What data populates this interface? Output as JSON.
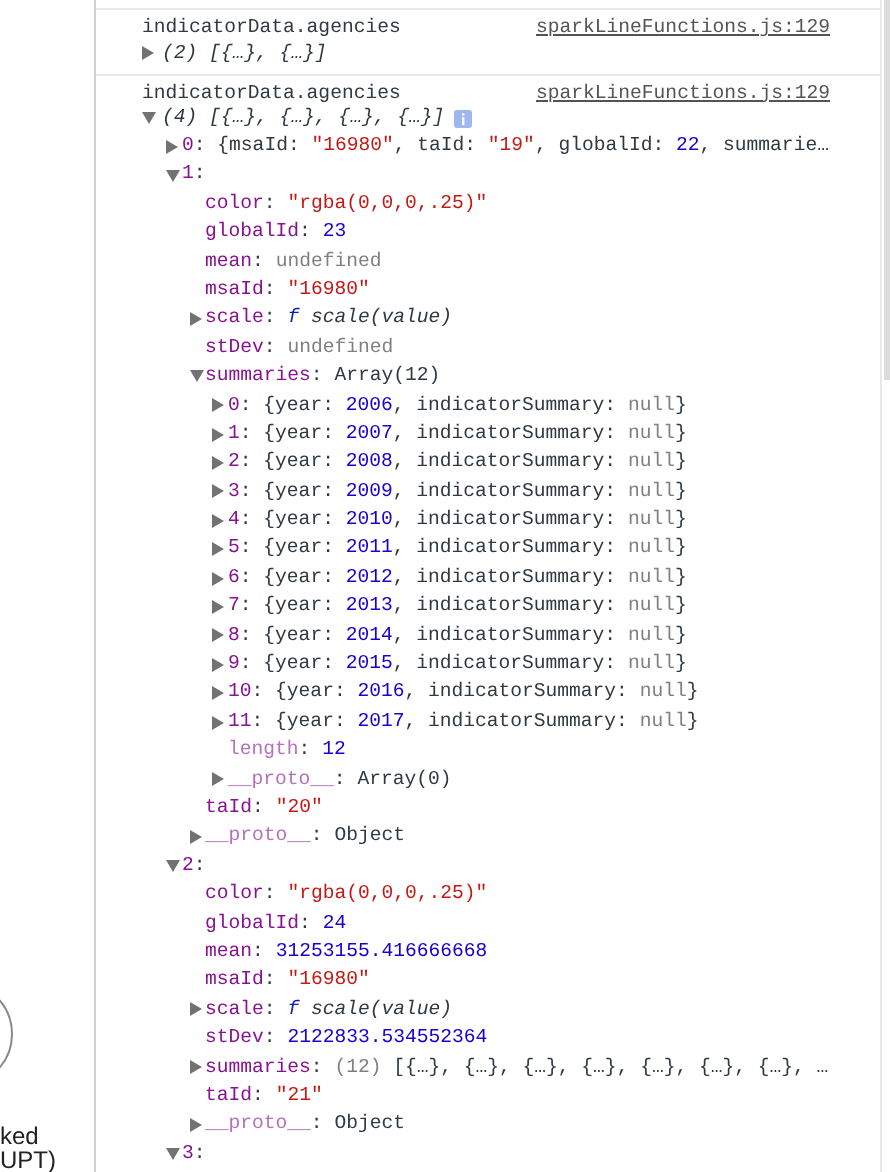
{
  "left_panel": {
    "texts": [
      "ked",
      "UPT)"
    ]
  },
  "console": {
    "messages": [
      {
        "label": "indicatorData.agencies",
        "source": "sparkLineFunctions.js:129",
        "tree": {
          "expanded": false,
          "summary": [
            {
              "text": "(2) [{…}, {…}]",
              "kind": "italic"
            }
          ]
        }
      },
      {
        "label": "indicatorData.agencies",
        "source": "sparkLineFunctions.js:129",
        "tree": {
          "expanded": true,
          "info_badge": true,
          "summary": [
            {
              "text": "(4) [{…}, {…}, {…}, {…}]",
              "kind": "italic"
            }
          ],
          "children": [
            {
              "key": "0:",
              "expanded": false,
              "value": [
                {
                  "text": "{msaId: ",
                  "kind": "plain"
                },
                {
                  "text": "\"16980\"",
                  "kind": "string"
                },
                {
                  "text": ", taId: ",
                  "kind": "plain"
                },
                {
                  "text": "\"19\"",
                  "kind": "string"
                },
                {
                  "text": ", globalId: ",
                  "kind": "plain"
                },
                {
                  "text": "22",
                  "kind": "number"
                },
                {
                  "text": ", summarie…",
                  "kind": "plain"
                }
              ]
            },
            {
              "key": "1:",
              "expanded": true,
              "children": [
                {
                  "key": "color:",
                  "value": [
                    {
                      "text": "\"rgba(0,0,0,.25)\"",
                      "kind": "string"
                    }
                  ]
                },
                {
                  "key": "globalId:",
                  "value": [
                    {
                      "text": "23",
                      "kind": "number"
                    }
                  ]
                },
                {
                  "key": "mean:",
                  "value": [
                    {
                      "text": "undefined",
                      "kind": "muted"
                    }
                  ]
                },
                {
                  "key": "msaId:",
                  "value": [
                    {
                      "text": "\"16980\"",
                      "kind": "string"
                    }
                  ]
                },
                {
                  "key": "scale:",
                  "expanded": false,
                  "value": [
                    {
                      "text": "f",
                      "kind": "function"
                    },
                    {
                      "text": " scale(value)",
                      "kind": "italic"
                    }
                  ]
                },
                {
                  "key": "stDev:",
                  "value": [
                    {
                      "text": "undefined",
                      "kind": "muted"
                    }
                  ]
                },
                {
                  "key": "summaries:",
                  "expanded": true,
                  "value": [
                    {
                      "text": "Array(12)",
                      "kind": "plain"
                    }
                  ],
                  "children": [
                    {
                      "key": "0:",
                      "expanded": false,
                      "value": [
                        {
                          "text": "{year: ",
                          "kind": "plain"
                        },
                        {
                          "text": "2006",
                          "kind": "number"
                        },
                        {
                          "text": ", indicatorSummary: ",
                          "kind": "plain"
                        },
                        {
                          "text": "null",
                          "kind": "muted"
                        },
                        {
                          "text": "}",
                          "kind": "plain"
                        }
                      ]
                    },
                    {
                      "key": "1:",
                      "expanded": false,
                      "value": [
                        {
                          "text": "{year: ",
                          "kind": "plain"
                        },
                        {
                          "text": "2007",
                          "kind": "number"
                        },
                        {
                          "text": ", indicatorSummary: ",
                          "kind": "plain"
                        },
                        {
                          "text": "null",
                          "kind": "muted"
                        },
                        {
                          "text": "}",
                          "kind": "plain"
                        }
                      ]
                    },
                    {
                      "key": "2:",
                      "expanded": false,
                      "value": [
                        {
                          "text": "{year: ",
                          "kind": "plain"
                        },
                        {
                          "text": "2008",
                          "kind": "number"
                        },
                        {
                          "text": ", indicatorSummary: ",
                          "kind": "plain"
                        },
                        {
                          "text": "null",
                          "kind": "muted"
                        },
                        {
                          "text": "}",
                          "kind": "plain"
                        }
                      ]
                    },
                    {
                      "key": "3:",
                      "expanded": false,
                      "value": [
                        {
                          "text": "{year: ",
                          "kind": "plain"
                        },
                        {
                          "text": "2009",
                          "kind": "number"
                        },
                        {
                          "text": ", indicatorSummary: ",
                          "kind": "plain"
                        },
                        {
                          "text": "null",
                          "kind": "muted"
                        },
                        {
                          "text": "}",
                          "kind": "plain"
                        }
                      ]
                    },
                    {
                      "key": "4:",
                      "expanded": false,
                      "value": [
                        {
                          "text": "{year: ",
                          "kind": "plain"
                        },
                        {
                          "text": "2010",
                          "kind": "number"
                        },
                        {
                          "text": ", indicatorSummary: ",
                          "kind": "plain"
                        },
                        {
                          "text": "null",
                          "kind": "muted"
                        },
                        {
                          "text": "}",
                          "kind": "plain"
                        }
                      ]
                    },
                    {
                      "key": "5:",
                      "expanded": false,
                      "value": [
                        {
                          "text": "{year: ",
                          "kind": "plain"
                        },
                        {
                          "text": "2011",
                          "kind": "number"
                        },
                        {
                          "text": ", indicatorSummary: ",
                          "kind": "plain"
                        },
                        {
                          "text": "null",
                          "kind": "muted"
                        },
                        {
                          "text": "}",
                          "kind": "plain"
                        }
                      ]
                    },
                    {
                      "key": "6:",
                      "expanded": false,
                      "value": [
                        {
                          "text": "{year: ",
                          "kind": "plain"
                        },
                        {
                          "text": "2012",
                          "kind": "number"
                        },
                        {
                          "text": ", indicatorSummary: ",
                          "kind": "plain"
                        },
                        {
                          "text": "null",
                          "kind": "muted"
                        },
                        {
                          "text": "}",
                          "kind": "plain"
                        }
                      ]
                    },
                    {
                      "key": "7:",
                      "expanded": false,
                      "value": [
                        {
                          "text": "{year: ",
                          "kind": "plain"
                        },
                        {
                          "text": "2013",
                          "kind": "number"
                        },
                        {
                          "text": ", indicatorSummary: ",
                          "kind": "plain"
                        },
                        {
                          "text": "null",
                          "kind": "muted"
                        },
                        {
                          "text": "}",
                          "kind": "plain"
                        }
                      ]
                    },
                    {
                      "key": "8:",
                      "expanded": false,
                      "value": [
                        {
                          "text": "{year: ",
                          "kind": "plain"
                        },
                        {
                          "text": "2014",
                          "kind": "number"
                        },
                        {
                          "text": ", indicatorSummary: ",
                          "kind": "plain"
                        },
                        {
                          "text": "null",
                          "kind": "muted"
                        },
                        {
                          "text": "}",
                          "kind": "plain"
                        }
                      ]
                    },
                    {
                      "key": "9:",
                      "expanded": false,
                      "value": [
                        {
                          "text": "{year: ",
                          "kind": "plain"
                        },
                        {
                          "text": "2015",
                          "kind": "number"
                        },
                        {
                          "text": ", indicatorSummary: ",
                          "kind": "plain"
                        },
                        {
                          "text": "null",
                          "kind": "muted"
                        },
                        {
                          "text": "}",
                          "kind": "plain"
                        }
                      ]
                    },
                    {
                      "key": "10:",
                      "expanded": false,
                      "value": [
                        {
                          "text": "{year: ",
                          "kind": "plain"
                        },
                        {
                          "text": "2016",
                          "kind": "number"
                        },
                        {
                          "text": ", indicatorSummary: ",
                          "kind": "plain"
                        },
                        {
                          "text": "null",
                          "kind": "muted"
                        },
                        {
                          "text": "}",
                          "kind": "plain"
                        }
                      ]
                    },
                    {
                      "key": "11:",
                      "expanded": false,
                      "value": [
                        {
                          "text": "{year: ",
                          "kind": "plain"
                        },
                        {
                          "text": "2017",
                          "kind": "number"
                        },
                        {
                          "text": ", indicatorSummary: ",
                          "kind": "plain"
                        },
                        {
                          "text": "null",
                          "kind": "muted"
                        },
                        {
                          "text": "}",
                          "kind": "plain"
                        }
                      ]
                    },
                    {
                      "key": "length:",
                      "dimmed": true,
                      "value": [
                        {
                          "text": "12",
                          "kind": "number"
                        }
                      ]
                    },
                    {
                      "key": "__proto__:",
                      "dimmed": true,
                      "expanded": false,
                      "value": [
                        {
                          "text": "Array(0)",
                          "kind": "plain"
                        }
                      ]
                    }
                  ]
                },
                {
                  "key": "taId:",
                  "value": [
                    {
                      "text": "\"20\"",
                      "kind": "string"
                    }
                  ]
                },
                {
                  "key": "__proto__:",
                  "dimmed": true,
                  "expanded": false,
                  "value": [
                    {
                      "text": "Object",
                      "kind": "plain"
                    }
                  ]
                }
              ]
            },
            {
              "key": "2:",
              "expanded": true,
              "children": [
                {
                  "key": "color:",
                  "value": [
                    {
                      "text": "\"rgba(0,0,0,.25)\"",
                      "kind": "string"
                    }
                  ]
                },
                {
                  "key": "globalId:",
                  "value": [
                    {
                      "text": "24",
                      "kind": "number"
                    }
                  ]
                },
                {
                  "key": "mean:",
                  "value": [
                    {
                      "text": "31253155.416666668",
                      "kind": "number"
                    }
                  ]
                },
                {
                  "key": "msaId:",
                  "value": [
                    {
                      "text": "\"16980\"",
                      "kind": "string"
                    }
                  ]
                },
                {
                  "key": "scale:",
                  "expanded": false,
                  "value": [
                    {
                      "text": "f",
                      "kind": "function"
                    },
                    {
                      "text": " scale(value)",
                      "kind": "italic"
                    }
                  ]
                },
                {
                  "key": "stDev:",
                  "value": [
                    {
                      "text": "2122833.534552364",
                      "kind": "number"
                    }
                  ]
                },
                {
                  "key": "summaries:",
                  "expanded": false,
                  "value": [
                    {
                      "text": "(12)",
                      "kind": "muted"
                    },
                    {
                      "text": " [{…}, {…}, {…}, {…}, {…}, {…}, {…}, …",
                      "kind": "plain"
                    }
                  ]
                },
                {
                  "key": "taId:",
                  "value": [
                    {
                      "text": "\"21\"",
                      "kind": "string"
                    }
                  ]
                },
                {
                  "key": "__proto__:",
                  "dimmed": true,
                  "expanded": false,
                  "value": [
                    {
                      "text": "Object",
                      "kind": "plain"
                    }
                  ]
                }
              ]
            },
            {
              "key": "3:",
              "expanded": true
            }
          ]
        }
      }
    ]
  }
}
